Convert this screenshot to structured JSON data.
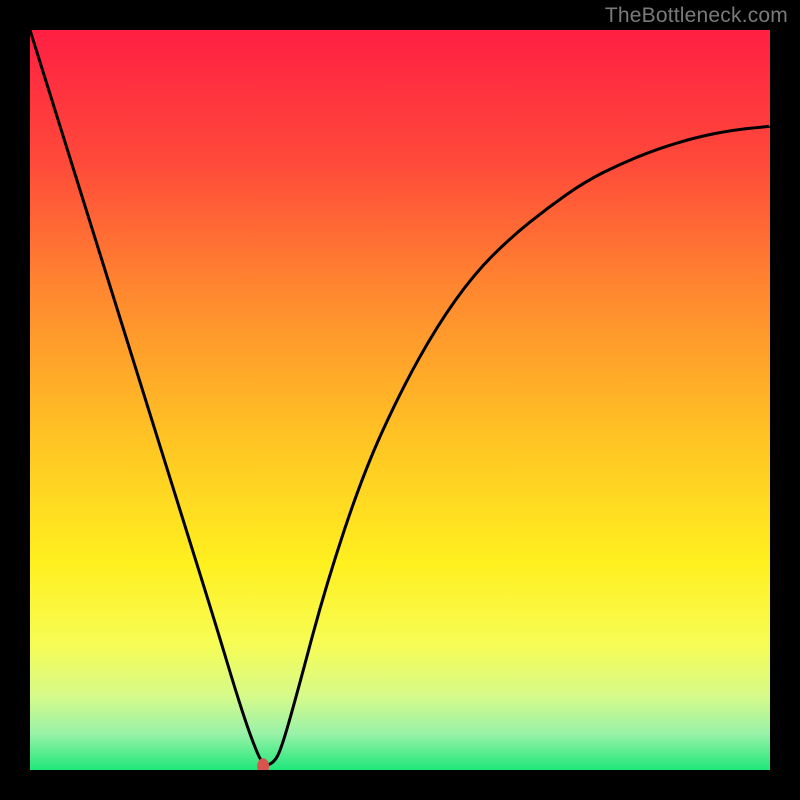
{
  "watermark": "TheBottleneck.com",
  "chart_data": {
    "type": "line",
    "title": "",
    "xlabel": "",
    "ylabel": "",
    "xlim": [
      0,
      100
    ],
    "ylim": [
      0,
      100
    ],
    "grid": false,
    "legend": false,
    "background": {
      "type": "vertical-gradient",
      "stops": [
        {
          "pos": 0.0,
          "color": "#ff1f43"
        },
        {
          "pos": 0.18,
          "color": "#ff4a3a"
        },
        {
          "pos": 0.36,
          "color": "#ff8a2f"
        },
        {
          "pos": 0.55,
          "color": "#ffc324"
        },
        {
          "pos": 0.72,
          "color": "#fff01f"
        },
        {
          "pos": 0.83,
          "color": "#f7fc55"
        },
        {
          "pos": 0.9,
          "color": "#d6fa8a"
        },
        {
          "pos": 0.95,
          "color": "#9af2a8"
        },
        {
          "pos": 1.0,
          "color": "#1fe87a"
        }
      ]
    },
    "series": [
      {
        "name": "bottleneck-curve",
        "color": "#000000",
        "x": [
          0,
          5,
          10,
          15,
          20,
          25,
          28,
          30,
          31.5,
          33,
          34,
          36,
          40,
          45,
          50,
          55,
          60,
          65,
          70,
          75,
          80,
          85,
          90,
          95,
          100
        ],
        "y": [
          100,
          84,
          68,
          52,
          36,
          20,
          10,
          4,
          0.5,
          1,
          3,
          10,
          25,
          40,
          51,
          60,
          67,
          72,
          76,
          79.5,
          82,
          84,
          85.5,
          86.5,
          87
        ]
      }
    ],
    "marker": {
      "name": "min-point",
      "x": 31.5,
      "y": 0.5,
      "color": "#d9534f",
      "rx": 6,
      "ry": 8
    }
  }
}
